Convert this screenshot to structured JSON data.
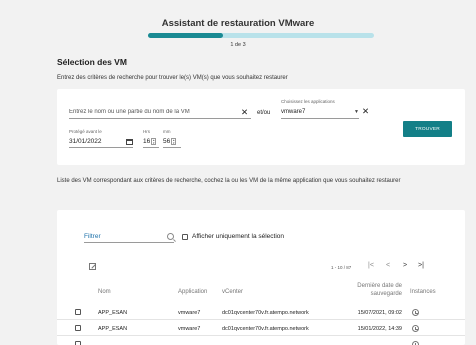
{
  "wizard": {
    "title": "Assistant de restauration VMware",
    "step_label": "1 de 3",
    "progress": 0.33,
    "accent": "#1a8a93"
  },
  "section": {
    "title": "Sélection des VM",
    "description": "Entrez des critères de recherche pour trouver le(s) VM(s) que vous souhaitez restaurer"
  },
  "search": {
    "name_placeholder": "Entrez le nom ou une partie du nom de la VM",
    "or_label": "et/ou",
    "app_label": "Choisissez les applications",
    "app_value": "vmware7",
    "date_label": "Protégé avant le",
    "date_value": "31/01/2022",
    "hours_label": "Hrs",
    "hours_value": "16",
    "minutes_label": "mm",
    "minutes_value": "56",
    "button_label": "TROUVER"
  },
  "results": {
    "description": "Liste des VM correspondant aux critères de recherche, cochez la ou les VM de la même application que vous souhaitez restaurer",
    "filter_label": "Filtrer",
    "only_selection_label": "Afficher uniquement la sélection",
    "page_info": "1 - 10 / 87",
    "pager": {
      "first": "|<",
      "prev": "<",
      "next": ">",
      "last": ">|"
    },
    "columns": {
      "name": "Nom",
      "app": "Application",
      "vcenter": "vCenter",
      "last_backup": "Dernière date de sauvegarde",
      "instances": "Instances"
    },
    "rows": [
      {
        "name": "APP_ESAN",
        "app": "vmware7",
        "vcenter": "dc01qvcenter70v.fr.atempo.network",
        "date": "15/07/2021, 09:02"
      },
      {
        "name": "APP_ESAN",
        "app": "vmware7",
        "vcenter": "dc01qvcenter70v.fr.atempo.network",
        "date": "15/01/2022, 14:39"
      },
      {
        "name": "",
        "app": "",
        "vcenter": "",
        "date": ""
      }
    ]
  }
}
